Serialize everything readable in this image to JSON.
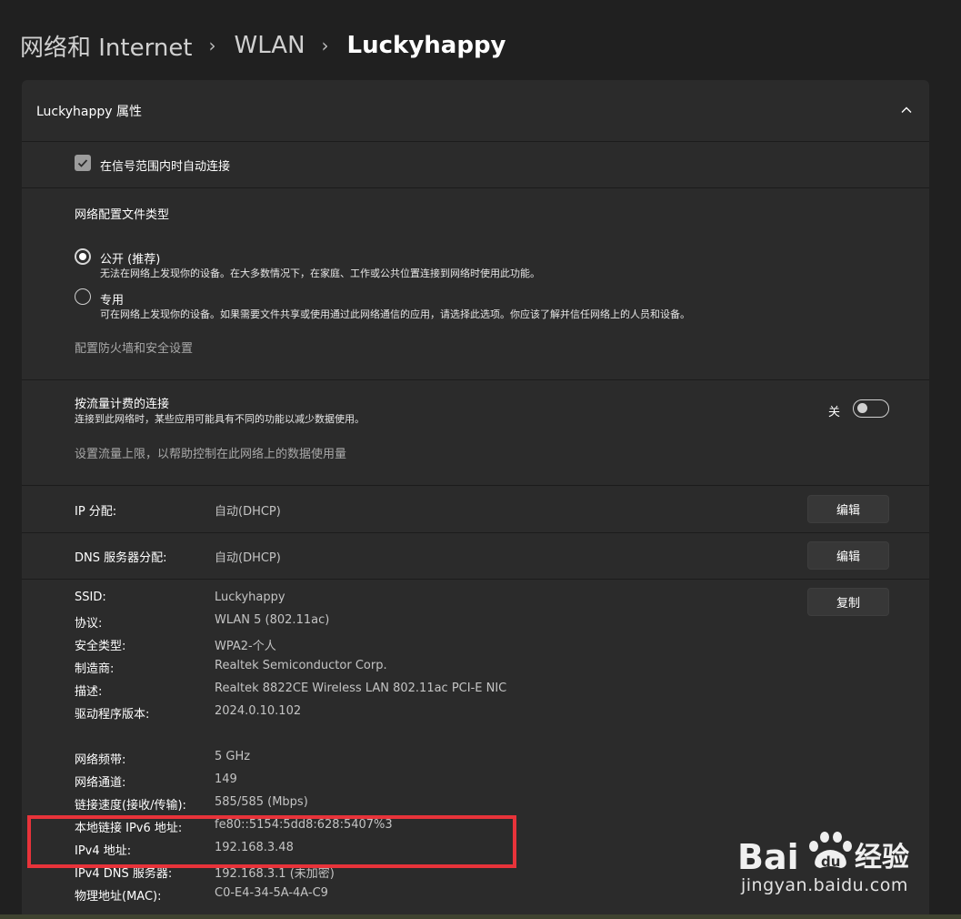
{
  "breadcrumb": {
    "part1": "网络和 Internet",
    "part2": "WLAN",
    "part3": "Luckyhappy",
    "separator": "›"
  },
  "card_title": "Luckyhappy 属性",
  "auto_connect_label": "在信号范围内时自动连接",
  "profile": {
    "heading": "网络配置文件类型",
    "public_label": "公开 (推荐)",
    "public_desc": "无法在网络上发现你的设备。在大多数情况下，在家庭、工作或公共位置连接到网络时使用此功能。",
    "private_label": "专用",
    "private_desc": "可在网络上发现你的设备。如果需要文件共享或使用通过此网络通信的应用，请选择此选项。你应该了解并信任网络上的人员和设备。",
    "firewall_link": "配置防火墙和安全设置"
  },
  "metered": {
    "title": "按流量计费的连接",
    "desc": "连接到此网络时，某些应用可能具有不同的功能以减少数据使用。",
    "toggle_state": "关",
    "link": "设置流量上限，以帮助控制在此网络上的数据使用量"
  },
  "ip_assignment": {
    "label": "IP 分配:",
    "value": "自动(DHCP)",
    "button": "编辑"
  },
  "dns_assignment": {
    "label": "DNS 服务器分配:",
    "value": "自动(DHCP)",
    "button": "编辑"
  },
  "copy_button": "复制",
  "properties": [
    {
      "label": "SSID:",
      "value": "Luckyhappy"
    },
    {
      "label": "协议:",
      "value": "WLAN 5 (802.11ac)"
    },
    {
      "label": "安全类型:",
      "value": "WPA2-个人"
    },
    {
      "label": "制造商:",
      "value": "Realtek Semiconductor Corp."
    },
    {
      "label": "描述:",
      "value": "Realtek 8822CE Wireless LAN 802.11ac PCI-E NIC"
    },
    {
      "label": "驱动程序版本:",
      "value": "2024.0.10.102"
    },
    {
      "label": "网络频带:",
      "value": "5 GHz"
    },
    {
      "label": "网络通道:",
      "value": "149"
    },
    {
      "label": "链接速度(接收/传输):",
      "value": "585/585 (Mbps)"
    },
    {
      "label": "本地链接 IPv6 地址:",
      "value": "fe80::5154:5dd8:628:5407%3"
    },
    {
      "label": "IPv4 地址:",
      "value": "192.168.3.48"
    },
    {
      "label": "IPv4 DNS 服务器:",
      "value": "192.168.3.1 (未加密)"
    },
    {
      "label": "物理地址(MAC):",
      "value": "C0-E4-34-5A-4A-C9"
    }
  ],
  "watermark": {
    "logo_text": "Bai du 经验",
    "url": "jingyan.baidu.com"
  },
  "colors": {
    "background": "#202020",
    "card": "#2b2b2b",
    "highlight_border": "#e8333a",
    "value_text": "#c4c4c4"
  }
}
